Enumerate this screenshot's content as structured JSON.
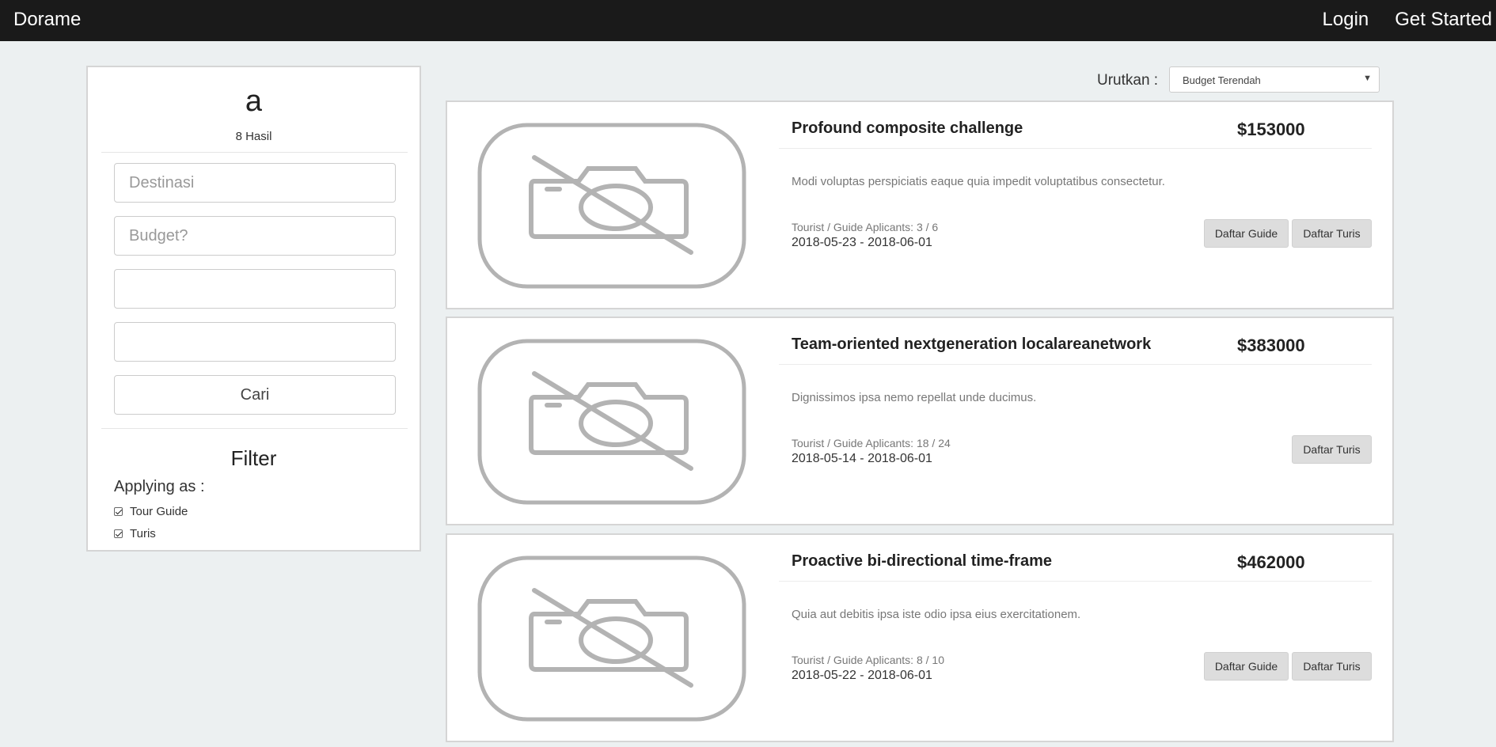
{
  "navbar": {
    "brand": "Dorame",
    "login": "Login",
    "get_started": "Get Started"
  },
  "sidebar": {
    "query": "a",
    "result_count": "8 Hasil",
    "destinasi_placeholder": "Destinasi",
    "budget_placeholder": "Budget?",
    "date_from_value": "",
    "date_to_value": "",
    "search_button": "Cari",
    "filter_title": "Filter",
    "applying_as_label": "Applying as :",
    "filters": [
      {
        "label": "Tour Guide",
        "checked": true
      },
      {
        "label": "Turis",
        "checked": true
      }
    ]
  },
  "sort": {
    "label": "Urutkan :",
    "selected": "Budget Terendah"
  },
  "listings": [
    {
      "title": "Profound composite challenge",
      "price": "$153000",
      "description": "Modi voluptas perspiciatis eaque quia impedit voluptatibus consectetur.",
      "applicants": "Tourist / Guide Aplicants: 3 / 6",
      "dates": "2018-05-23 - 2018-06-01",
      "guide_button": "Daftar Guide",
      "turis_button": "Daftar Turis"
    },
    {
      "title": "Team-oriented nextgeneration localareanetwork",
      "price": "$383000",
      "description": "Dignissimos ipsa nemo repellat unde ducimus.",
      "applicants": "Tourist / Guide Aplicants: 18 / 24",
      "dates": "2018-05-14 - 2018-06-01",
      "turis_button": "Daftar Turis"
    },
    {
      "title": "Proactive bi-directional time-frame",
      "price": "$462000",
      "description": "Quia aut debitis ipsa iste odio ipsa eius exercitationem.",
      "applicants": "Tourist / Guide Aplicants: 8 / 10",
      "dates": "2018-05-22 - 2018-06-01",
      "guide_button": "Daftar Guide",
      "turis_button": "Daftar Turis"
    }
  ],
  "icons": {
    "no_image": "no-camera-icon",
    "sort_caret": "caret-down-icon",
    "checkbox": "checkbox-checked-icon"
  },
  "colors": {
    "navbar_bg": "#1a1a1a",
    "page_bg": "#ecf0f1",
    "button_bg": "#dddddd",
    "placeholder_icon": "#b3b3b3"
  }
}
